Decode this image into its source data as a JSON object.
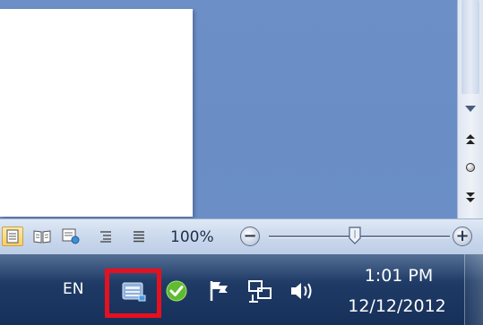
{
  "statusbar": {
    "views": [
      {
        "name": "print-layout",
        "active": true
      },
      {
        "name": "full-screen-reading",
        "active": false
      },
      {
        "name": "web-layout",
        "active": false
      },
      {
        "name": "outline",
        "active": false
      },
      {
        "name": "draft",
        "active": false
      }
    ],
    "zoom_level": "100%",
    "zoom_out_symbol": "−",
    "zoom_in_symbol": "+"
  },
  "scrollbar": {
    "prev_page_symbol": "⯭",
    "next_page_symbol": "⯯"
  },
  "taskbar": {
    "language": "EN",
    "tray_icons": [
      "keyboard-icon",
      "security-check-icon",
      "action-center-flag-icon",
      "network-icon",
      "volume-icon"
    ],
    "time": "1:01 PM",
    "date": "12/12/2012"
  },
  "colors": {
    "highlight": "#e8101e",
    "taskbar": "#1e3a64",
    "workspace": "#6a8dc6"
  }
}
